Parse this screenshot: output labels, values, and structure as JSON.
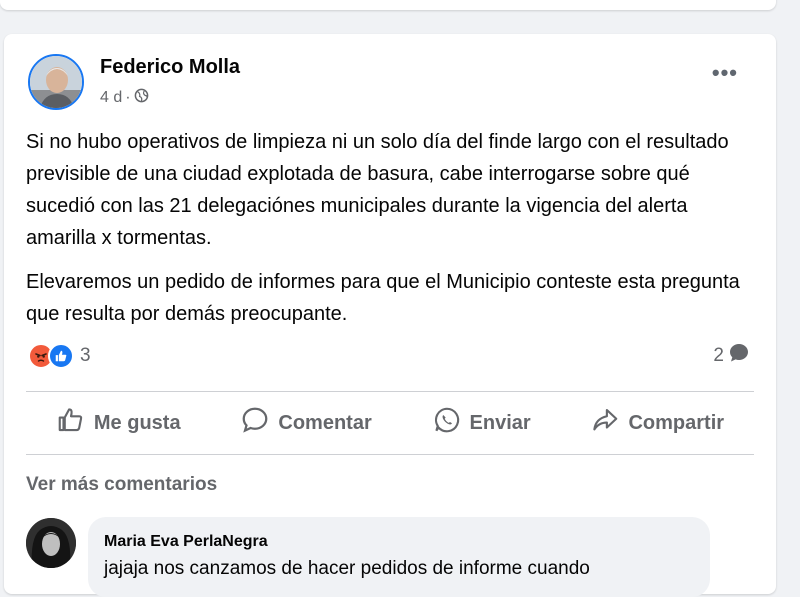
{
  "post": {
    "author": "Federico Molla",
    "time": "4 d",
    "separator": "·",
    "privacy_icon": "globe-icon",
    "paragraphs": [
      "Si no hubo operativos de limpieza ni un solo día del finde largo con el resultado previsible de una ciudad explotada de basura, cabe interrogarse sobre qué sucedió con las 21 delegaciónes municipales durante la vigencia del alerta amarilla x tormentas.",
      "Elevaremos un pedido de informes para que el Municipio conteste esta pregunta que resulta por demás preocupante."
    ],
    "reaction_count": "3",
    "comment_count": "2"
  },
  "actions": {
    "like": "Me gusta",
    "comment": "Comentar",
    "send": "Enviar",
    "share": "Compartir"
  },
  "comments": {
    "more_label": "Ver más comentarios",
    "items": [
      {
        "author": "Maria Eva PerlaNegra",
        "text": "jajaja nos canzamos de hacer pedidos de informe cuando"
      }
    ]
  },
  "colors": {
    "accent": "#1877f2",
    "angry": "#f25a3b",
    "secondary_text": "#65676b"
  }
}
